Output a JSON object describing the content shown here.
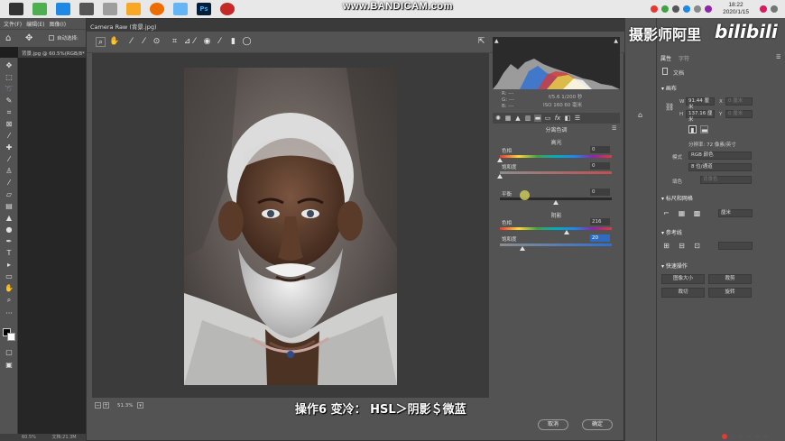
{
  "taskbar": {
    "apps": [
      "#2a2a2a",
      "#2e7d32",
      "#1565c0",
      "#555",
      "#444",
      "#f59e0b",
      "#e85d2a",
      "#3ea0e8",
      "#001e36",
      "#c62828"
    ],
    "ps_label": "Ps",
    "watermark": "www.BANDICAM.com",
    "clock_time": "18:22",
    "clock_date": "2020/1/15"
  },
  "ps": {
    "menu": [
      "文件(F)",
      "编辑(E)",
      "图像(I)"
    ],
    "options_label": "自动选择:",
    "doc_tab": "背景.jpg @ 60.5%(RGB/8*",
    "status_zoom": "60.5%",
    "status_doc": "文档:21.3M"
  },
  "camera_raw": {
    "title": "Camera Raw (背景.jpg)",
    "zoom": "51.3%",
    "caption": "操作6  变冷： HSL＞阴影＄微蓝",
    "readout": {
      "r": "R:  ---",
      "g": "G:  ---",
      "b": "B:  ---",
      "exposure": "f/5.6   1/200 秒",
      "iso": "ISO 160   60 毫米"
    },
    "panel_title": "分离色调",
    "highlights": {
      "section": "高光",
      "hue_label": "色相",
      "hue_value": "0",
      "sat_label": "饱和度",
      "sat_value": "0"
    },
    "balance": {
      "label": "平衡",
      "value": "0"
    },
    "shadows": {
      "section": "阴影",
      "hue_label": "色相",
      "hue_value": "216",
      "sat_label": "饱和度",
      "sat_value": "20"
    },
    "cancel_label": "取消",
    "ok_label": "确定"
  },
  "props": {
    "watermark": "摄影师阿里",
    "bili": "bilibili",
    "tab_properties": "属性",
    "tab_other": "字符",
    "doc_label": "文档",
    "canvas_head": "画布",
    "w_label": "W",
    "w_value": "91.44 厘米",
    "x_label": "X",
    "x_value": "0 厘米",
    "h_label": "H",
    "h_value": "137.16 厘米",
    "y_label": "Y",
    "y_value": "0 厘米",
    "resolution": "分辨率: 72 像素/英寸",
    "mode_label": "模式",
    "mode_value": "RGB 颜色",
    "depth_value": "8 位/通道",
    "fill_label": "填色",
    "fill_value": "背景色",
    "rulers_head": "标尺和网格",
    "units_value": "厘米",
    "guides_head": "参考线",
    "quick_head": "快速操作",
    "btn_image_size": "图像大小",
    "btn_crop": "裁剪",
    "btn_trim": "裁切",
    "btn_rotate": "旋转"
  },
  "colors": {
    "shadow_hue_thumb": "#e0e0e0",
    "accent": "#2d6cc0"
  }
}
